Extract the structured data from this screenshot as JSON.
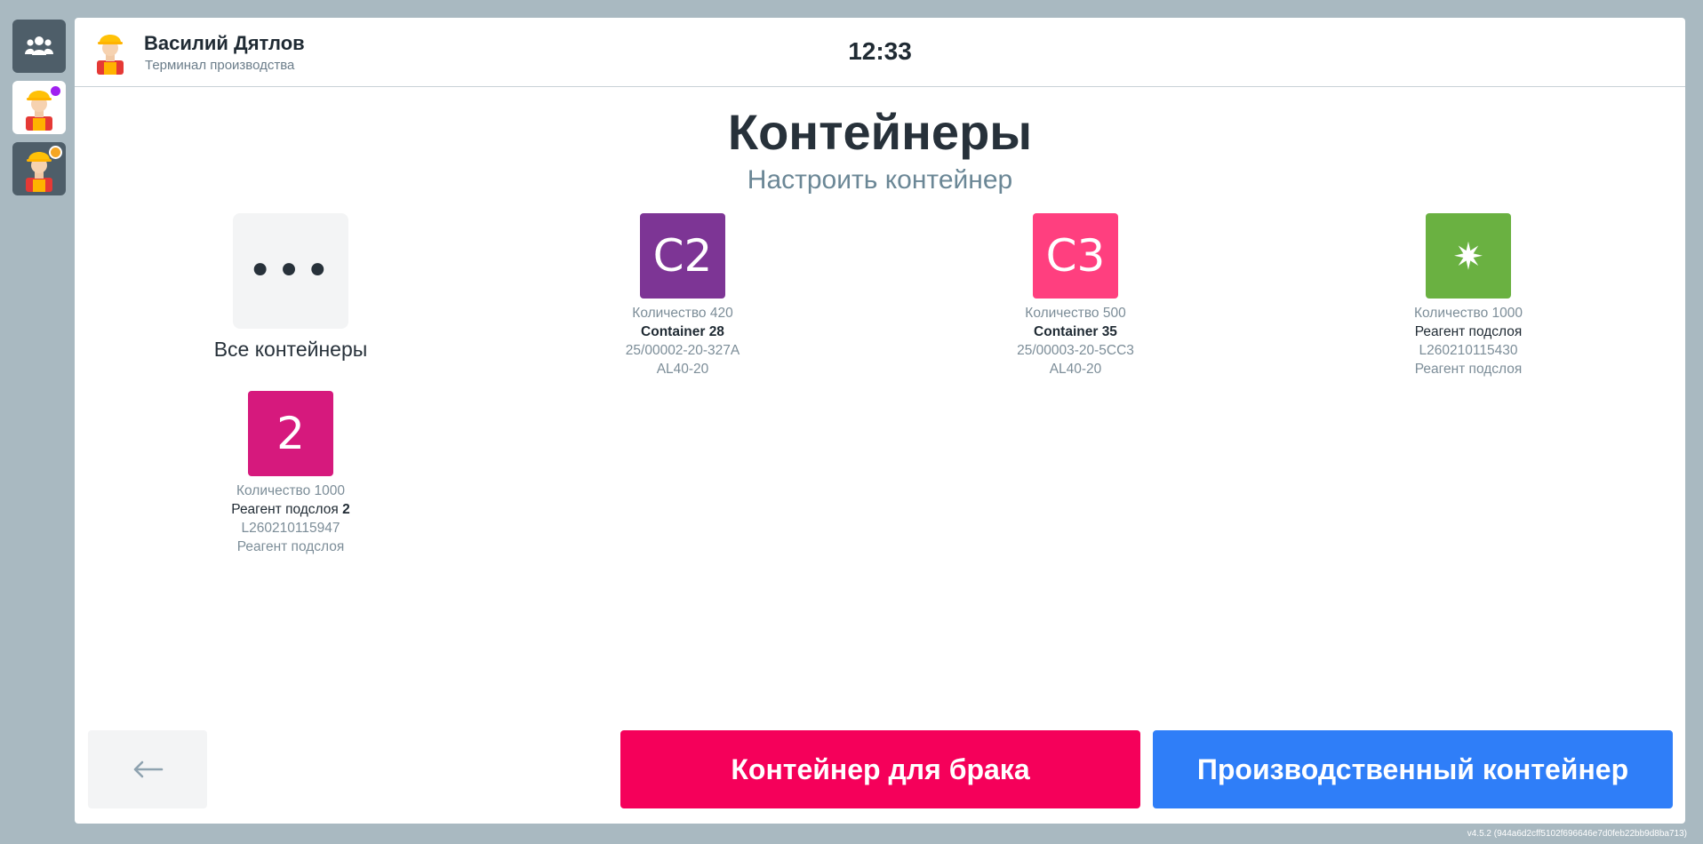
{
  "sidebar": {
    "items": [
      {
        "name": "group-icon"
      },
      {
        "name": "worker-avatar-1",
        "dot_color": "#a020f0"
      },
      {
        "name": "worker-avatar-2",
        "dot_color": "#f5a623"
      }
    ]
  },
  "header": {
    "user_name": "Василий Дятлов",
    "user_role": "Терминал производства",
    "clock": "12:33"
  },
  "page": {
    "title": "Контейнеры",
    "subtitle": "Настроить контейнер"
  },
  "all_containers": {
    "icon_text": "•••",
    "label": "Все контейнеры"
  },
  "containers": [
    {
      "badge": "C2",
      "color": "#7d3595",
      "qty": "Количество 420",
      "name": "Container 28",
      "code": "25/00002-20-327A",
      "extra": "AL40-20"
    },
    {
      "badge": "C3",
      "color": "#ff3f7f",
      "qty": "Количество 500",
      "name": "Container 35",
      "code": "25/00003-20-5CC3",
      "extra": "AL40-20"
    },
    {
      "badge": "✷",
      "color": "#6ab141",
      "qty": "Количество 1000",
      "name": "Реагент подслоя",
      "code": "L260210115430",
      "extra": "Реагент подслоя"
    },
    {
      "badge": "2",
      "color": "#d6197d",
      "qty": "Количество 1000",
      "name_prefix": "Реагент подслоя ",
      "name_suffix": "2",
      "code": "L260210115947",
      "extra": "Реагент подслоя"
    }
  ],
  "buttons": {
    "back_icon": "arrow-left-icon",
    "defect": "Контейнер для брака",
    "production": "Производственный контейнер"
  },
  "version": "v4.5.2 (944a6d2cff5102f696646e7d0feb22bb9d8ba713)",
  "colors": {
    "defect": "#f5005a",
    "production": "#2f7ef8",
    "background": "#a9b9c1"
  }
}
